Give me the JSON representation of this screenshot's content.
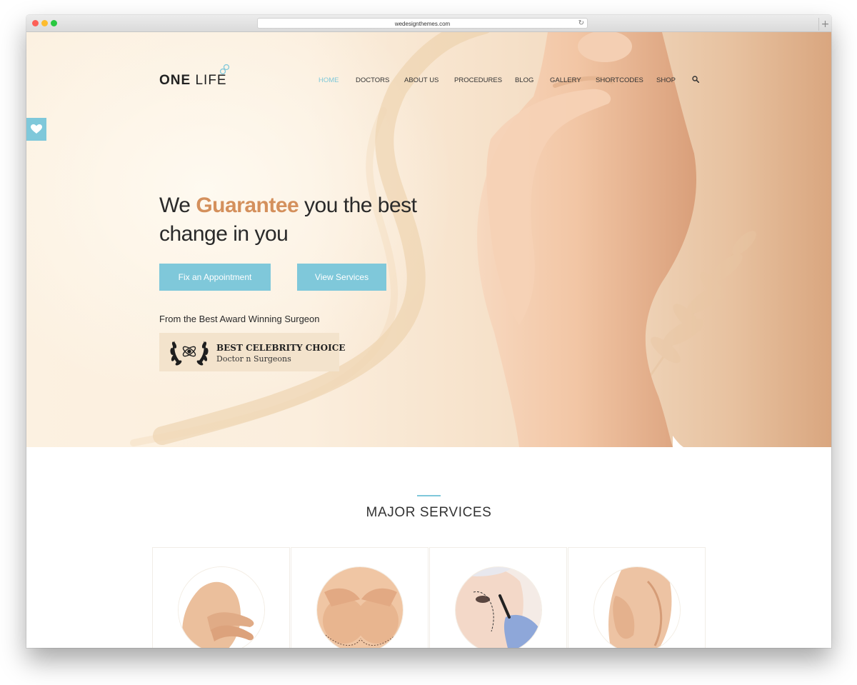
{
  "browser": {
    "url": "wedesignthemes.com",
    "reload_icon": "reload-icon",
    "newtab_icon": "plus-icon"
  },
  "brand": {
    "name_bold": "ONE",
    "name_light": "LIFE",
    "accent_color": "#7fc8da",
    "highlight_color": "#d4905c"
  },
  "nav": {
    "items": [
      {
        "label": "HOME",
        "active": true
      },
      {
        "label": "DOCTORS"
      },
      {
        "label": "ABOUT US"
      },
      {
        "label": "PROCEDURES"
      },
      {
        "label": "BLOG"
      },
      {
        "label": "GALLERY"
      },
      {
        "label": "SHORTCODES"
      },
      {
        "label": "SHOP"
      }
    ],
    "search_icon": "search-icon"
  },
  "sidebar": {
    "favorite_icon": "heart-icon"
  },
  "hero": {
    "headline_before": "We",
    "headline_accent": "Guarantee",
    "headline_after_1": "you the best",
    "headline_after_2": "change in you",
    "primary_button": "Fix an Appointment",
    "secondary_button": "View Services",
    "award_caption": "From the Best Award Winning Surgeon",
    "award_title": "BEST CELEBRITY CHOICE",
    "award_subtitle": "Doctor n Surgeons"
  },
  "services": {
    "title": "MAJOR SERVICES",
    "cards": [
      {
        "image": "breast-procedure-photo"
      },
      {
        "image": "breast-augmentation-photo"
      },
      {
        "image": "facial-surgery-photo"
      },
      {
        "image": "body-contour-photo"
      }
    ]
  }
}
